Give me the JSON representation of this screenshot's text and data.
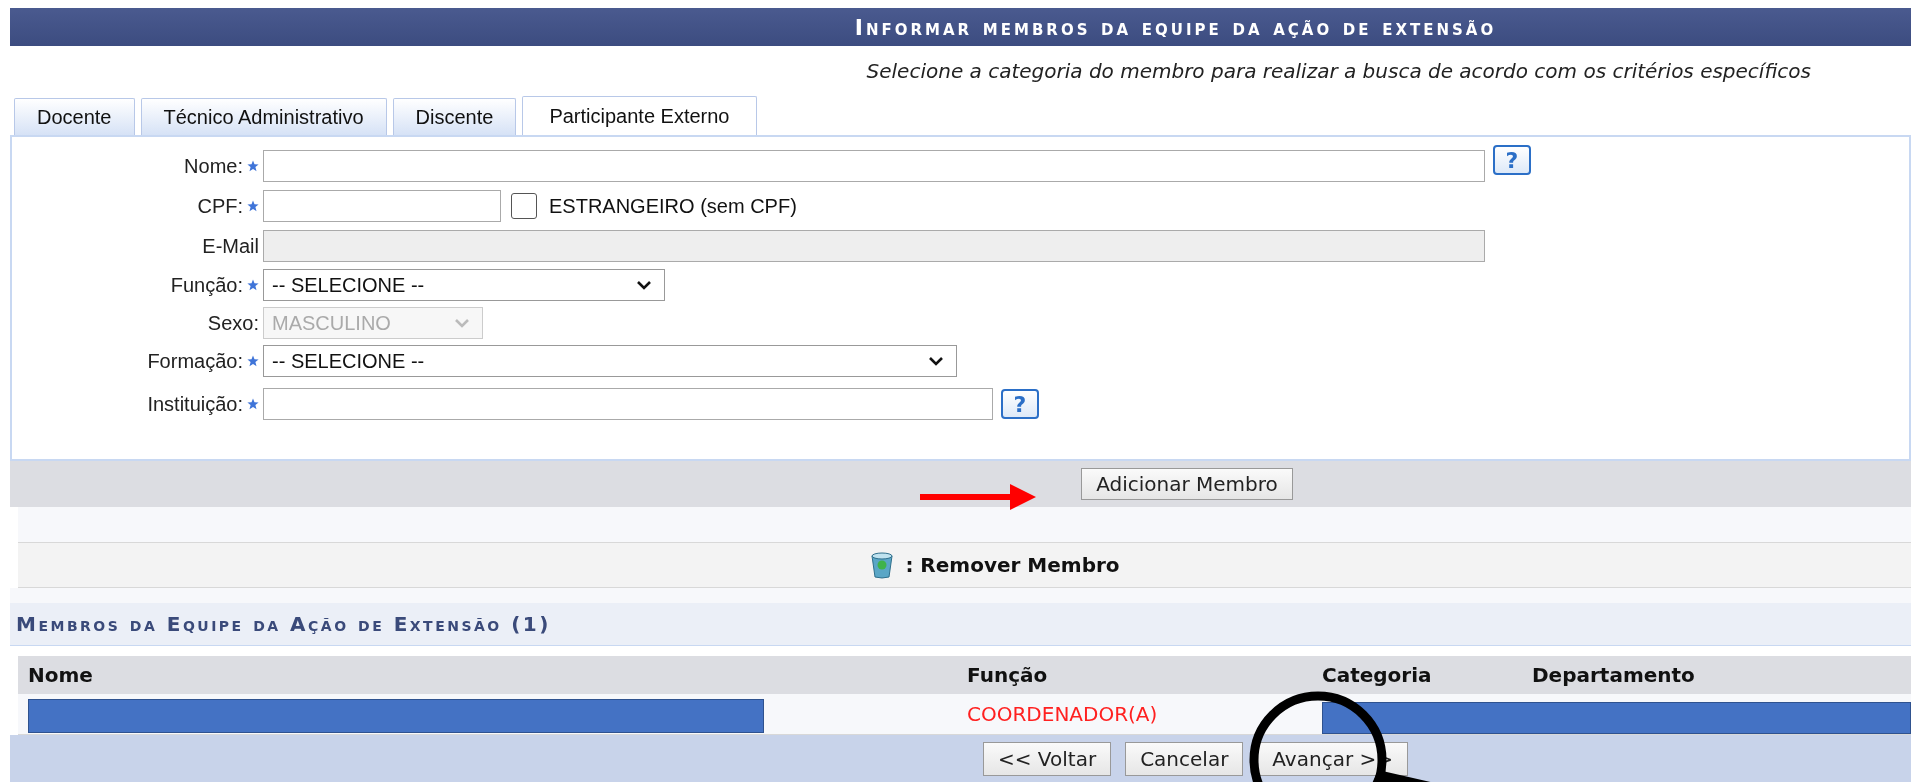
{
  "title": "Informar membros da equipe da ação de extensão",
  "subtitle": "Selecione a categoria do membro para realizar a busca de acordo com os critérios específicos",
  "tabs": [
    {
      "label": "Docente",
      "selected": false
    },
    {
      "label": "Técnico Administrativo",
      "selected": false
    },
    {
      "label": "Discente",
      "selected": false
    },
    {
      "label": "Participante Externo",
      "selected": true
    }
  ],
  "form": [
    {
      "kind": "text",
      "label": "Nome:",
      "required": true,
      "help": "?"
    },
    {
      "kind": "cpf",
      "label": "CPF:",
      "required": true,
      "checkbox_label": "ESTRANGEIRO (sem CPF)",
      "checked": false
    },
    {
      "kind": "text",
      "label": "E-Mail",
      "required": false,
      "disabled": true
    },
    {
      "kind": "select",
      "label": "Função:",
      "required": true,
      "value": "-- SELECIONE --"
    },
    {
      "kind": "select",
      "label": "Sexo:",
      "required": false,
      "value": "MASCULINO",
      "disabled": true
    },
    {
      "kind": "select",
      "label": "Formação:",
      "required": true,
      "value": "-- SELECIONE --"
    },
    {
      "kind": "text",
      "label": "Instituição:",
      "required": true,
      "help": "?"
    }
  ],
  "add_button": "Adicionar Membro",
  "legend": ": Remover Membro",
  "members": {
    "title": "Membros da Equipe da Ação de Extensão (1)",
    "columns": [
      "Nome",
      "Função",
      "Categoria",
      "Departamento"
    ],
    "rows": [
      {
        "nome_redacted": true,
        "funcao": "COORDENADOR(A)",
        "categoria_departamento_redacted": true
      }
    ]
  },
  "buttons": [
    "<< Voltar",
    "Cancelar",
    "Avançar >>"
  ],
  "annotations": [
    {
      "kind": "arrow"
    },
    {
      "kind": "magnifier"
    }
  ]
}
